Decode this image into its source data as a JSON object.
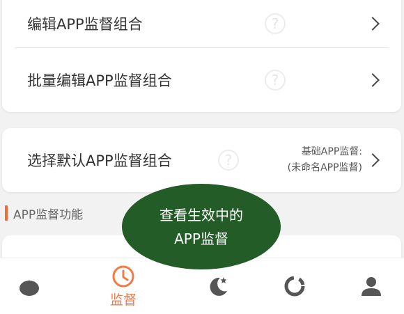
{
  "settings": {
    "rows": [
      {
        "label": "编辑APP监督组合",
        "help": "?"
      },
      {
        "label": "批量编辑APP监督组合",
        "help": "?"
      }
    ],
    "default_row": {
      "label": "选择默认APP监督组合",
      "help": "?",
      "value_line1": "基础APP监督:",
      "value_line2": "(未命名APP监督)"
    }
  },
  "section": {
    "title": "APP监督功能"
  },
  "toast": {
    "line1": "查看生效中的",
    "line2": "APP监督"
  },
  "tabbar": {
    "tabs": [
      {
        "icon": "tomato-icon"
      },
      {
        "icon": "clock-icon",
        "label": "监督",
        "active": true
      },
      {
        "icon": "moon-star-icon"
      },
      {
        "icon": "ring-chart-icon"
      },
      {
        "icon": "person-icon"
      }
    ]
  },
  "colors": {
    "accent": "#f07b48",
    "toast_bg": "#245c28",
    "icon_gray": "#555555"
  }
}
